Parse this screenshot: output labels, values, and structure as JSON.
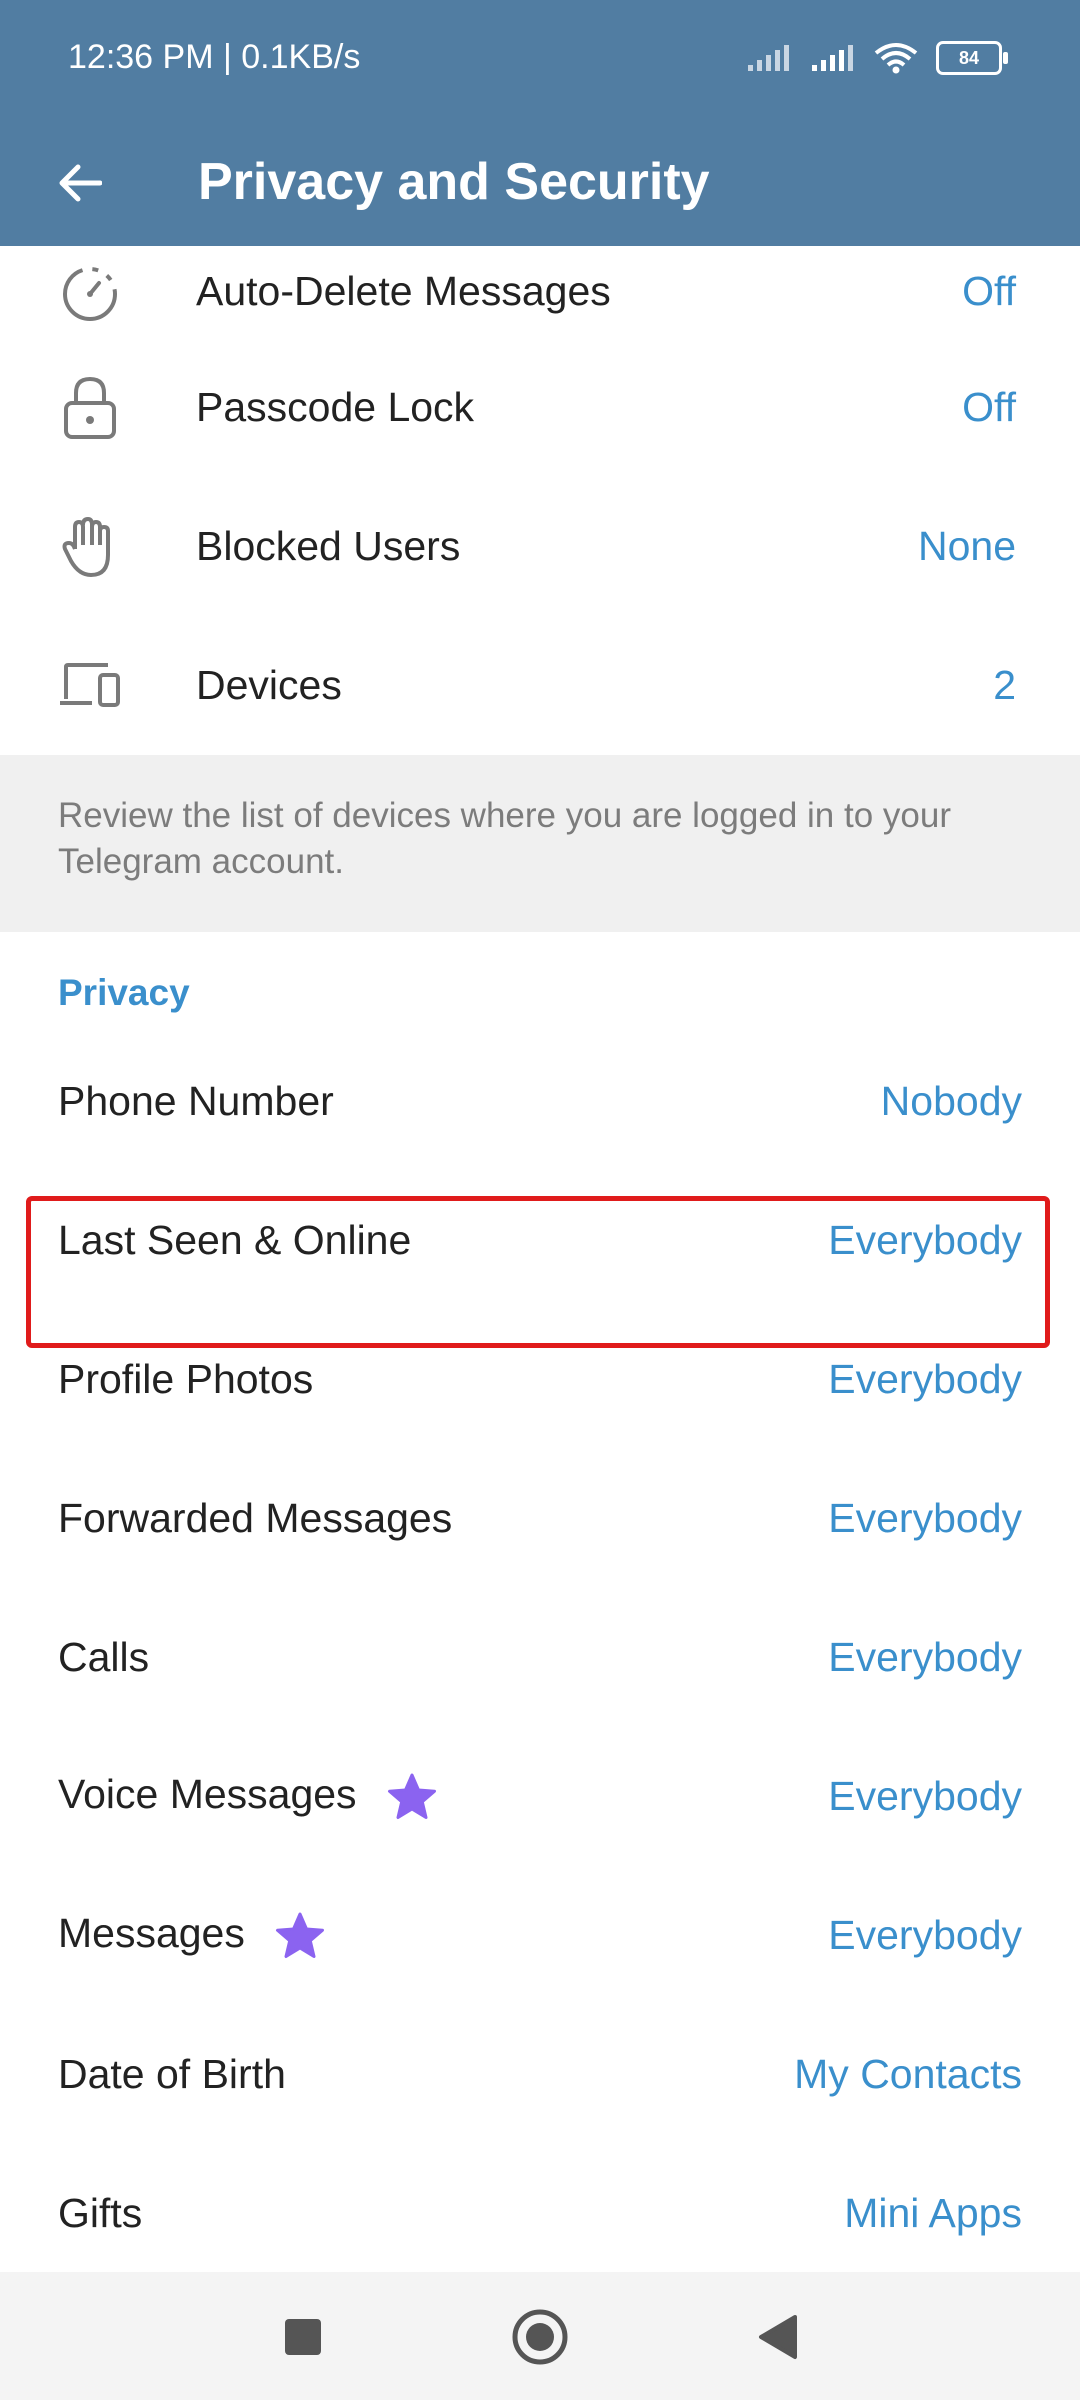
{
  "status": {
    "time": "12:36 PM | 0.1KB/s",
    "battery": "84"
  },
  "header": {
    "title": "Privacy and Security"
  },
  "security_items": [
    {
      "label": "Auto-Delete Messages",
      "value": "Off",
      "icon": "timer-icon"
    },
    {
      "label": "Passcode Lock",
      "value": "Off",
      "icon": "lock-icon"
    },
    {
      "label": "Blocked Users",
      "value": "None",
      "icon": "hand-icon"
    },
    {
      "label": "Devices",
      "value": "2",
      "icon": "devices-icon"
    }
  ],
  "devices_info": "Review the list of devices where you are logged in to your Telegram account.",
  "privacy": {
    "header": "Privacy",
    "items": [
      {
        "label": "Phone Number",
        "value": "Nobody"
      },
      {
        "label": "Last Seen & Online",
        "value": "Everybody"
      },
      {
        "label": "Profile Photos",
        "value": "Everybody"
      },
      {
        "label": "Forwarded Messages",
        "value": "Everybody"
      },
      {
        "label": "Calls",
        "value": "Everybody"
      },
      {
        "label": "Voice Messages",
        "value": "Everybody"
      },
      {
        "label": "Messages",
        "value": "Everybody"
      },
      {
        "label": "Date of Birth",
        "value": "My Contacts"
      },
      {
        "label": "Gifts",
        "value": "Mini Apps"
      }
    ]
  },
  "colors": {
    "header_bg": "#517da2",
    "accent": "#3a8fcc",
    "premium_star": "#8b63f0",
    "highlight": "#e01b1b"
  }
}
